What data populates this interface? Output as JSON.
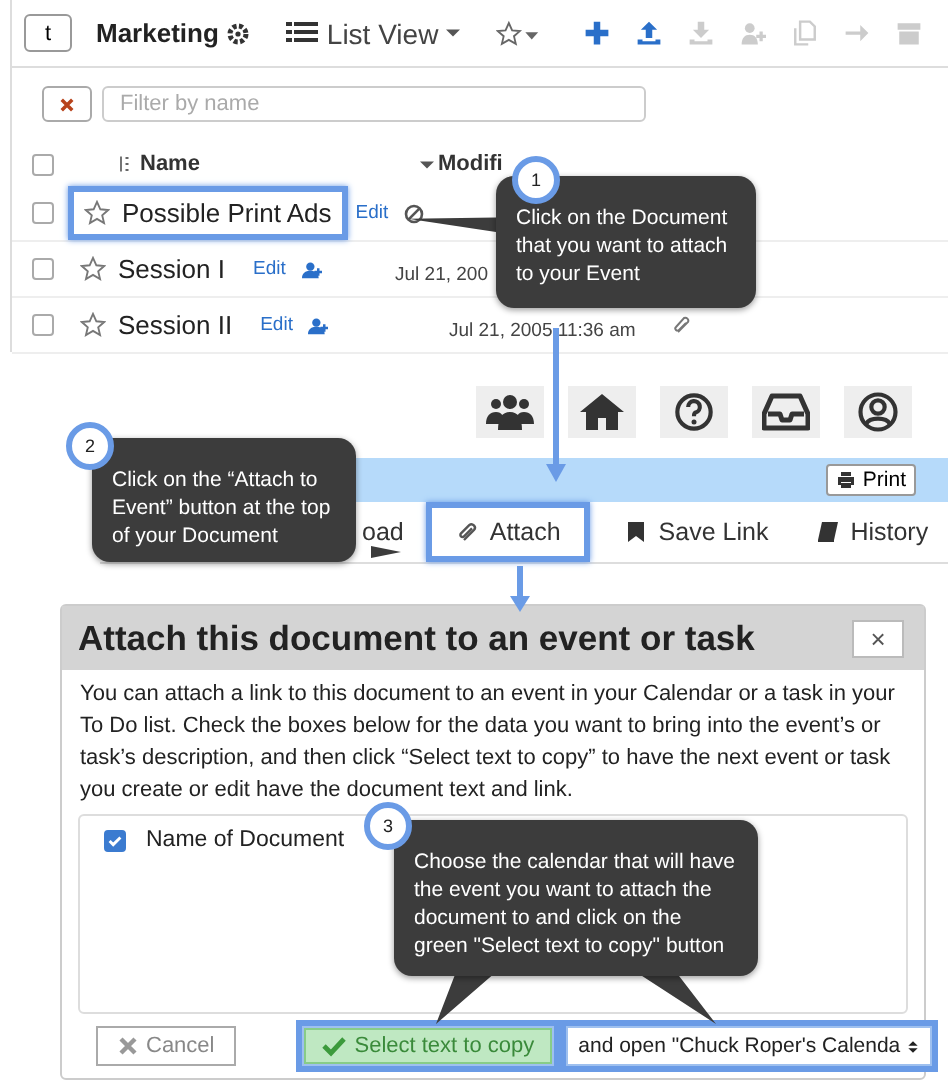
{
  "toolbar": {
    "folder_button": "t",
    "folder_name": "Marketing",
    "view_menu": "List View"
  },
  "filter": {
    "placeholder": "Filter by name"
  },
  "select_all_checked": false,
  "columns": [
    "Name",
    "Modifi"
  ],
  "documents": [
    {
      "name": "Possible Print Ads",
      "edit": "Edit",
      "kind": "ban",
      "highlighted": true,
      "checked": false,
      "starred": false
    },
    {
      "name": "Session I",
      "edit": "Edit",
      "kind": "share",
      "modified": "Jul 21, 200",
      "highlighted": false,
      "checked": false,
      "starred": false
    },
    {
      "name": "Session II",
      "edit": "Edit",
      "kind": "share",
      "modified": "Jul 21, 2005 11:36 am",
      "attachment": true,
      "highlighted": false,
      "checked": false,
      "starred": false
    }
  ],
  "print_button": "Print",
  "doc_tabs": [
    {
      "label": "oad",
      "kind": "plain",
      "highlighted": false
    },
    {
      "label": "Attach",
      "kind": "attach",
      "highlighted": true
    },
    {
      "label": "Save Link",
      "kind": "bookmark",
      "highlighted": false
    },
    {
      "label": "History",
      "kind": "history",
      "highlighted": false
    }
  ],
  "dialog": {
    "title": "Attach this document to an event or task",
    "close": "×",
    "text": "You can attach a link to this document to an event in your Calendar or a task in your To Do list. Check the boxes below for the data you want to bring into the event’s or task’s description, and then click “Select text to copy” to have the next event or task you create or edit have the document text and link.",
    "fields": [
      {
        "label": "Name of Document",
        "checked": true
      }
    ],
    "cancel": "Cancel",
    "submit": {
      "label": "Select text to copy",
      "highlighted": true
    },
    "target": {
      "value": "and open \"Chuck Roper's Calenda",
      "highlighted": true
    }
  },
  "steps": [
    {
      "number": "1",
      "text": "Click on the Document that you want to attach to your Event"
    },
    {
      "number": "2",
      "text": "Click on the “Attach to Event” button at the top of your Document"
    },
    {
      "number": "3",
      "text": "Choose the calendar that will have the event you want to attach the document to and click on the green \"Select text to copy\" button"
    }
  ]
}
